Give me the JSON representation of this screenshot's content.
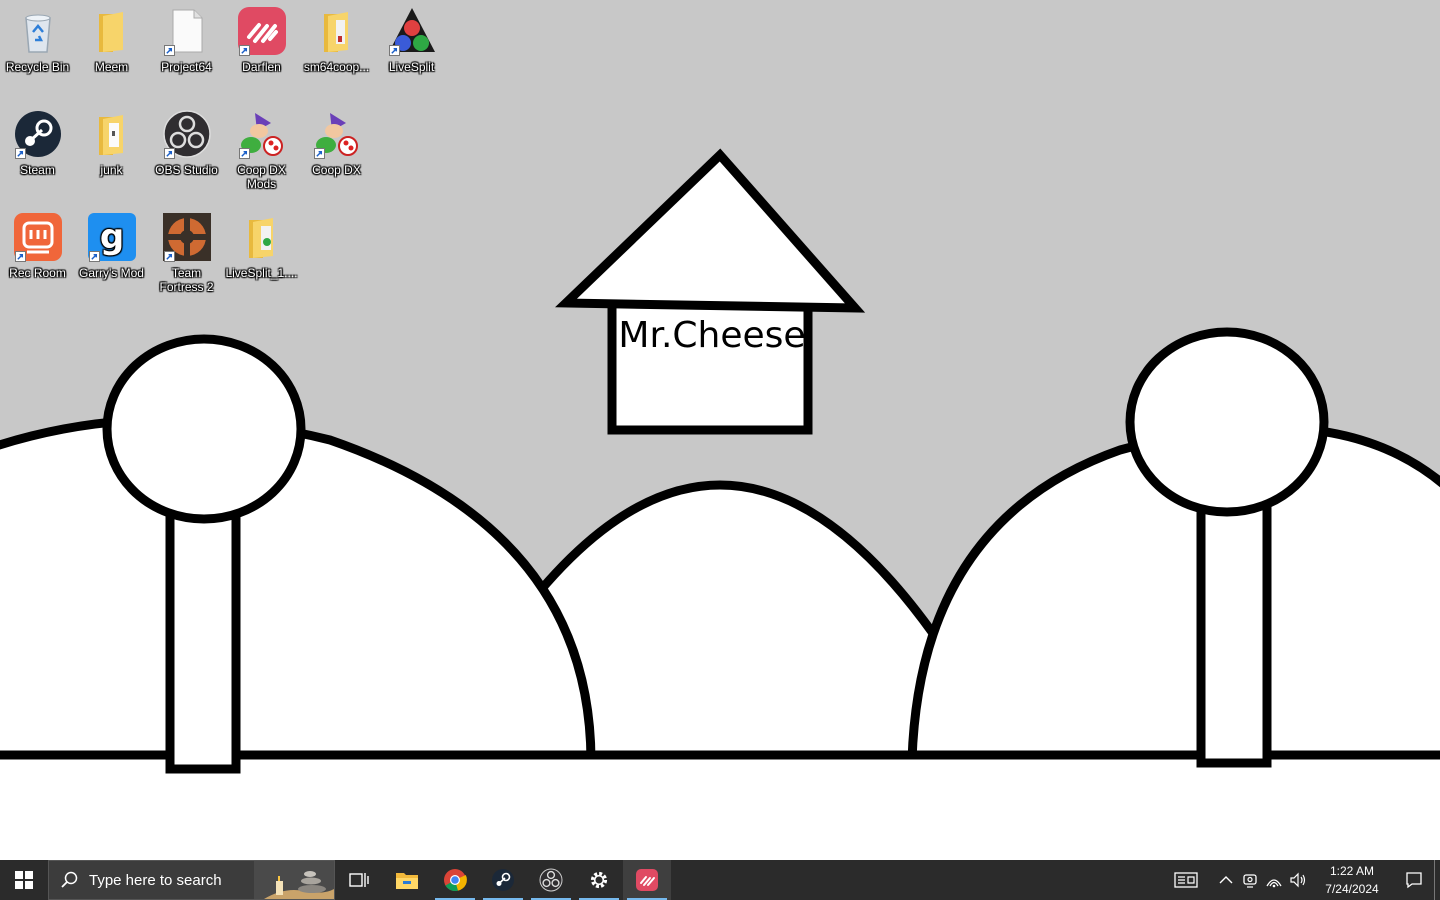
{
  "desktop": {
    "icons": [
      {
        "label": "Recycle Bin",
        "icon": "recycle-bin-icon"
      },
      {
        "label": "Meem",
        "icon": "folder-icon"
      },
      {
        "label": "Project64",
        "icon": "blank-file-icon"
      },
      {
        "label": "Darflen",
        "icon": "darflen-icon"
      },
      {
        "label": "sm64coop...",
        "icon": "folder-icon"
      },
      {
        "label": "LiveSplit",
        "icon": "livesplit-icon"
      },
      {
        "label": "Steam",
        "icon": "steam-icon"
      },
      {
        "label": "junk",
        "icon": "folder-icon"
      },
      {
        "label": "OBS Studio",
        "icon": "obs-icon"
      },
      {
        "label": "Coop DX Mods",
        "icon": "coop-dx-icon"
      },
      {
        "label": "Coop DX",
        "icon": "coop-dx-icon"
      },
      {
        "label": "Rec Room",
        "icon": "rec-room-icon"
      },
      {
        "label": "Garry's Mod",
        "icon": "garrys-mod-icon"
      },
      {
        "label": "Team Fortress 2",
        "icon": "tf2-icon"
      },
      {
        "label": "LiveSplit_1....",
        "icon": "folder-icon"
      }
    ]
  },
  "wallpaper": {
    "sign_text": "Mr.Cheese",
    "colors": {
      "sky": "#c8c8c8",
      "fill": "#ffffff",
      "outline": "#000000"
    }
  },
  "taskbar": {
    "search_placeholder": "Type here to search",
    "apps": [
      {
        "name": "task-view",
        "icon": "task-view-icon"
      },
      {
        "name": "file-explorer",
        "icon": "file-explorer-icon"
      },
      {
        "name": "chrome",
        "icon": "chrome-icon"
      },
      {
        "name": "steam",
        "icon": "steam-icon"
      },
      {
        "name": "obs",
        "icon": "obs-icon"
      },
      {
        "name": "settings",
        "icon": "gear-icon"
      },
      {
        "name": "darflen",
        "icon": "darflen-icon"
      }
    ],
    "clock": {
      "time": "1:22 AM",
      "date": "7/24/2024"
    },
    "colors": {
      "background": "#2b2b2b",
      "active_indicator": "#76b9ed"
    }
  }
}
